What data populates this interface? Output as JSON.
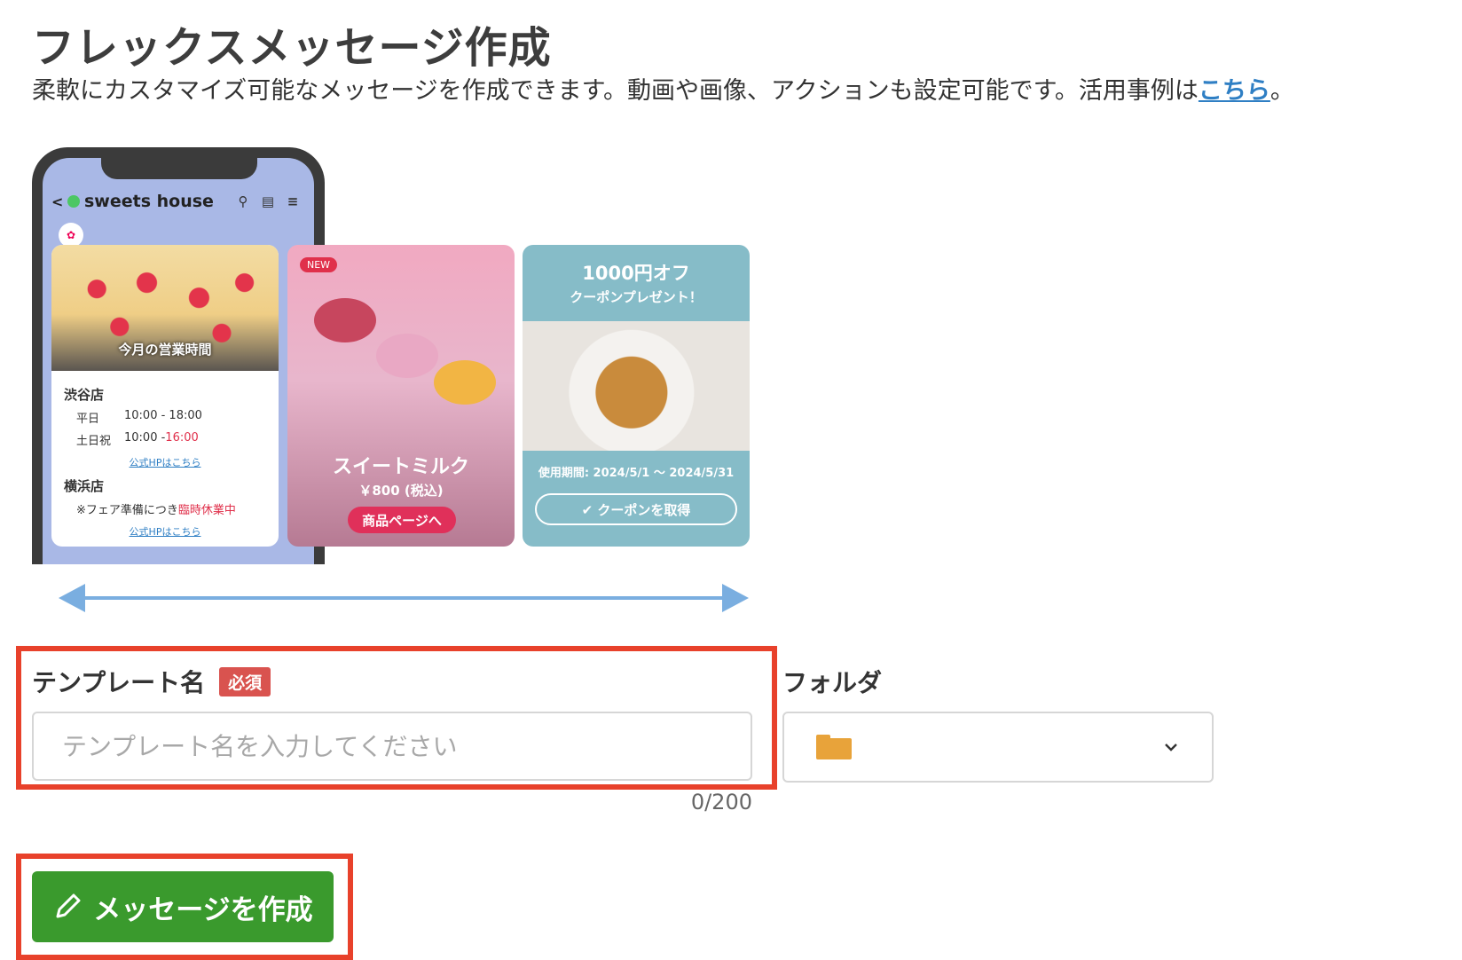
{
  "page": {
    "title": "フレックスメッセージ作成",
    "description": "柔軟にカスタマイズ可能なメッセージを作成できます。動画や画像、アクションも設定可能です。活用事例は",
    "description_link": "こちら",
    "description_end": "。"
  },
  "preview": {
    "account_name": "sweets house",
    "card1": {
      "caption": "今月の営業時間",
      "store1": "渋谷店",
      "weekday_label": "平日",
      "weekday_hours": "10:00 - 18:00",
      "holiday_label": "土日祝",
      "holiday_open": "10:00 - ",
      "holiday_close": "16:00",
      "hp_link1": "公式HPはこちら",
      "store2": "横浜店",
      "note_prefix": "※フェア準備につき ",
      "note_red": "臨時休業中",
      "hp_link2": "公式HPはこちら"
    },
    "card2": {
      "badge": "NEW",
      "title": "スイートミルク",
      "price": "￥800 (税込)",
      "button": "商品ページへ"
    },
    "card3": {
      "headline": "1000円オフ",
      "subheadline": "クーポンプレゼント！",
      "period": "使用期間: 2024/5/1 ～ 2024/5/31",
      "button": "✔ クーポンを取得"
    }
  },
  "form": {
    "template_label": "テンプレート名",
    "required_badge": "必須",
    "template_placeholder": "テンプレート名を入力してください",
    "template_value": "",
    "counter": "0/200",
    "folder_label": "フォルダ",
    "folder_icon": "folder-icon"
  },
  "actions": {
    "create_label": "メッセージを作成"
  },
  "colors": {
    "accent_green": "#3a9a2d",
    "required_red": "#d9534f",
    "highlight": "#e8412b",
    "link_blue": "#2f7fc4",
    "folder": "#e8a33a"
  }
}
